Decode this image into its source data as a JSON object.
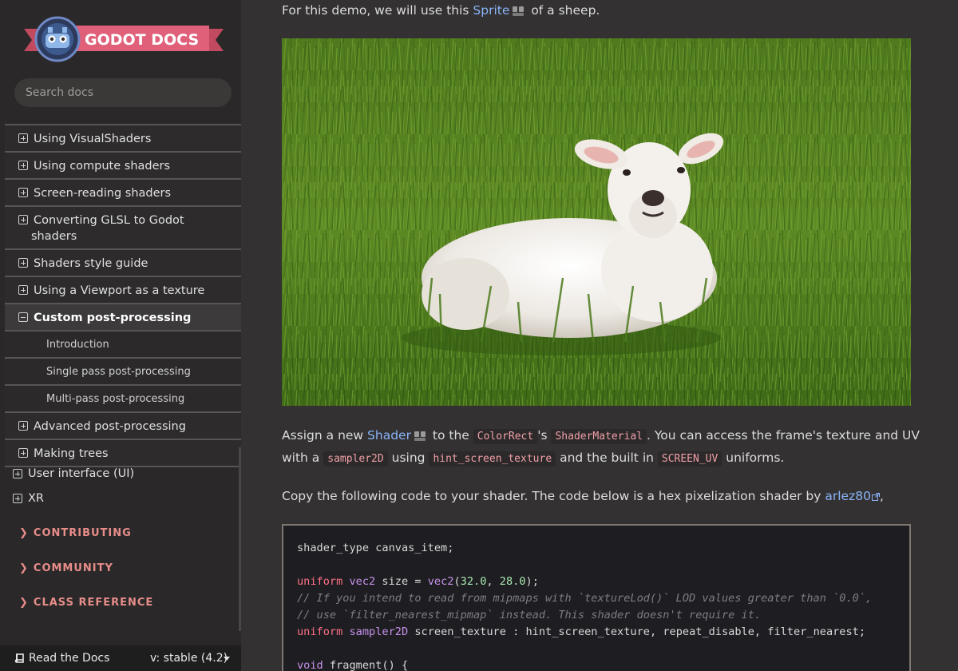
{
  "sidebar": {
    "logo_text": "GODOT DOCS",
    "search_placeholder": "Search docs",
    "toc_items": [
      {
        "label": "Using VisualShaders"
      },
      {
        "label": "Using compute shaders"
      },
      {
        "label": "Screen-reading shaders"
      },
      {
        "label_line1": "Converting GLSL to Godot",
        "label_line2": "shaders"
      },
      {
        "label": "Shaders style guide"
      },
      {
        "label": "Using a Viewport as a texture"
      },
      {
        "label": "Custom post-processing"
      },
      {
        "label": "Introduction"
      },
      {
        "label": "Single pass post-processing"
      },
      {
        "label": "Multi-pass post-processing"
      },
      {
        "label": "Advanced post-processing"
      },
      {
        "label": "Making trees"
      }
    ],
    "level1_items": [
      {
        "label": "User interface (UI)"
      },
      {
        "label": "XR"
      }
    ],
    "captions": [
      {
        "chevron": "❯",
        "label": "CONTRIBUTING"
      },
      {
        "chevron": "❯",
        "label": "COMMUNITY"
      },
      {
        "chevron": "❯",
        "label": "CLASS REFERENCE"
      }
    ],
    "rtd": {
      "label": "Read the Docs",
      "version": "v: stable (4.2)"
    }
  },
  "content": {
    "p1": {
      "before": "For this demo, we will use this ",
      "link": "Sprite",
      "after": " of a sheep."
    },
    "p2": {
      "t1": "Assign a new ",
      "link": "Shader",
      "t2": " to the ",
      "code1": "ColorRect",
      "t3": "'s ",
      "code2": "ShaderMaterial",
      "t4": ". You can access the frame's texture and UV",
      "t5": "with a ",
      "code3": "sampler2D",
      "t6": " using ",
      "code4": "hint_screen_texture",
      "t7": " and the built in ",
      "code5": "SCREEN_UV",
      "t8": " uniforms."
    },
    "p3": {
      "before": "Copy the following code to your shader. The code below is a hex pixelization shader by ",
      "link": "arlez80",
      "after": ","
    },
    "code": {
      "l1": "shader_type canvas_item;",
      "l3_kw": "uniform",
      "l3_ty": "vec2",
      "l3_a": " size = ",
      "l3_fn": "vec2",
      "l3_b": "(",
      "l3_n1": "32.0",
      "l3_c": ", ",
      "l3_n2": "28.0",
      "l3_d": ");",
      "l4": "// If you intend to read from mipmaps with `textureLod()` LOD values greater than `0.0`,",
      "l5": "// use `filter_nearest_mipmap` instead. This shader doesn't require it.",
      "l6_kw": "uniform",
      "l6_ty": "sampler2D",
      "l6_rest": " screen_texture : hint_screen_texture, repeat_disable, filter_nearest;",
      "l8_ty": "void",
      "l8_rest": " fragment() {"
    }
  },
  "colors": {
    "accent": "#e78d8a",
    "link": "#8ab4f8",
    "logo_ribbon": "#e0607a"
  }
}
